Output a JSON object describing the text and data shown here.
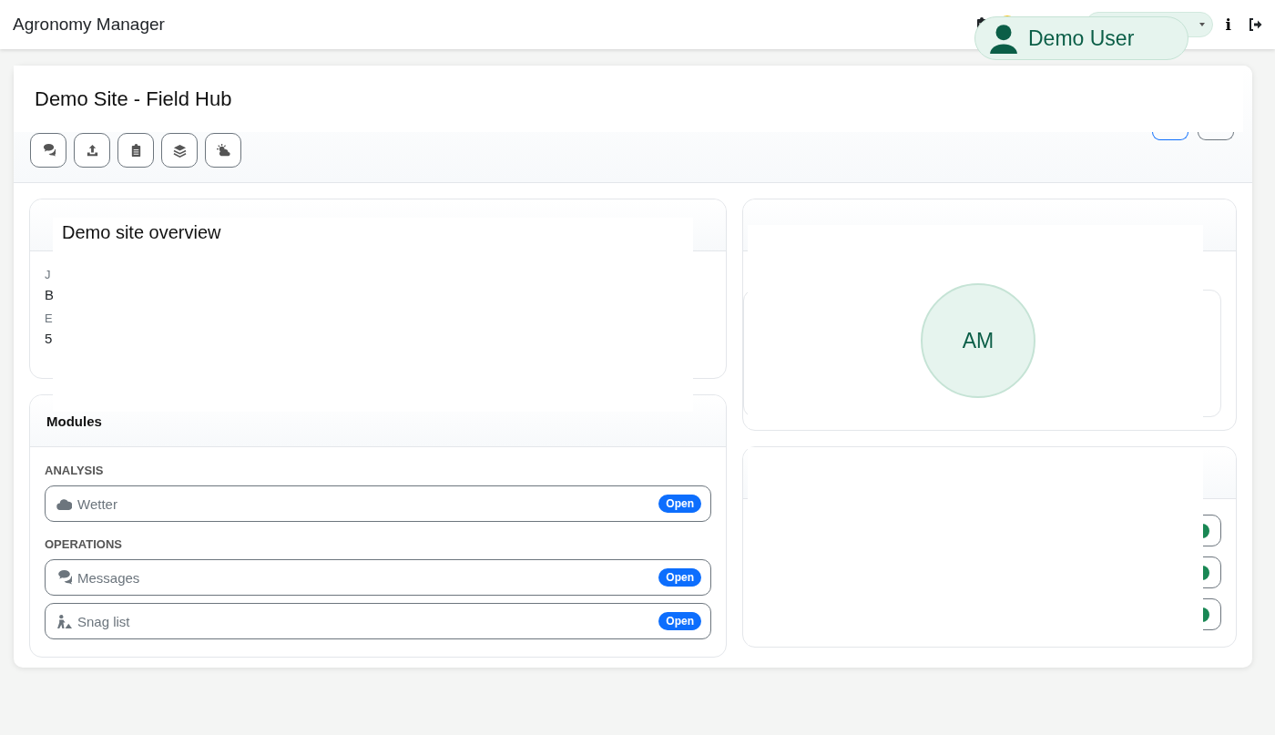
{
  "app_title": "Agronomy Manager",
  "info_label": "i",
  "user_overlay": {
    "name": "Demo User"
  },
  "site_title": "Demo Site - Field Hub",
  "overview": {
    "overlay_title": "Demo site overview",
    "fields": [
      {
        "label": "J",
        "value": "B"
      },
      {
        "label": "E",
        "value": "5"
      }
    ]
  },
  "modules": {
    "title": "Modules",
    "groups": [
      {
        "heading": "ANALYSIS",
        "items": [
          {
            "label": "Wetter",
            "action": "Open"
          }
        ]
      },
      {
        "heading": "OPERATIONS",
        "items": [
          {
            "label": "Messages",
            "action": "Open"
          },
          {
            "label": "Snag list",
            "action": "Open"
          }
        ]
      }
    ]
  },
  "avatar": {
    "initials": "AM"
  }
}
